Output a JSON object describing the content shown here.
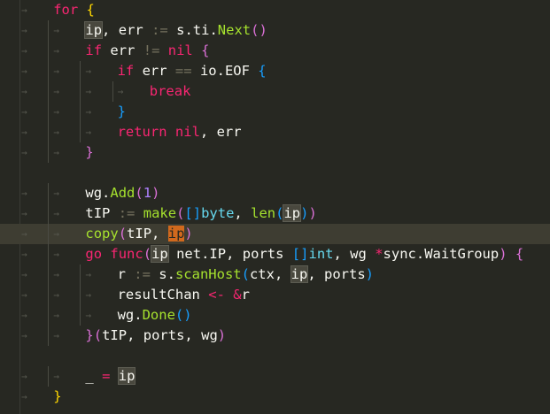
{
  "editor": {
    "language": "go",
    "theme_colors": {
      "background": "#272822",
      "keyword": "#f92672",
      "function": "#a6e22e",
      "number": "#ae81ff",
      "type": "#66d9ef",
      "bracket_gold": "#ffd700",
      "bracket_orchid": "#da70d6",
      "bracket_blue": "#179fff",
      "selection_match": "#d1691d",
      "current_line": "#3e3d32"
    },
    "lines": [
      "for {",
      "ip, err := s.ti.Next()",
      "if err != nil {",
      "if err == io.EOF {",
      "break",
      "}",
      "return nil, err",
      "}",
      "",
      "wg.Add(1)",
      "tIP := make([]byte, len(ip))",
      "copy(tIP, ip)",
      "go func(ip net.IP, ports []int, wg *sync.WaitGroup) {",
      "r := s.scanHost(ctx, ip, ports)",
      "resultChan <- &r",
      "wg.Done()",
      "}(tIP, ports, wg)",
      "",
      "_ = ip",
      "}"
    ],
    "indent_glyph": "→",
    "current_line_index": 11
  }
}
